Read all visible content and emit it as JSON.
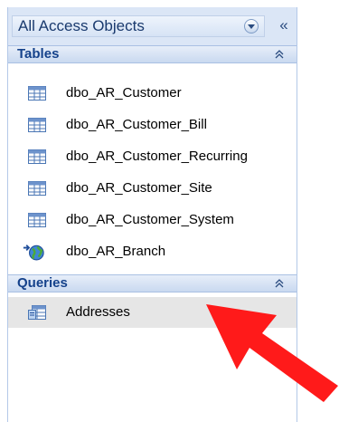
{
  "nav_pane": {
    "title": "All Access Objects",
    "shutter_glyph": "«",
    "groups": [
      {
        "label": "Tables",
        "collapse_glyph": "≈",
        "items": [
          {
            "label": "dbo_AR_Customer",
            "icon": "table-icon"
          },
          {
            "label": "dbo_AR_Customer_Bill",
            "icon": "table-icon"
          },
          {
            "label": "dbo_AR_Customer_Recurring",
            "icon": "table-icon"
          },
          {
            "label": "dbo_AR_Customer_Site",
            "icon": "table-icon"
          },
          {
            "label": "dbo_AR_Customer_System",
            "icon": "table-icon"
          },
          {
            "label": "dbo_AR_Branch",
            "icon": "linked-table-globe-icon"
          }
        ]
      },
      {
        "label": "Queries",
        "collapse_glyph": "≈",
        "items": [
          {
            "label": "Addresses",
            "icon": "query-icon",
            "selected": true
          }
        ]
      }
    ]
  },
  "annotation": {
    "arrow_color": "#ff1a1a"
  }
}
